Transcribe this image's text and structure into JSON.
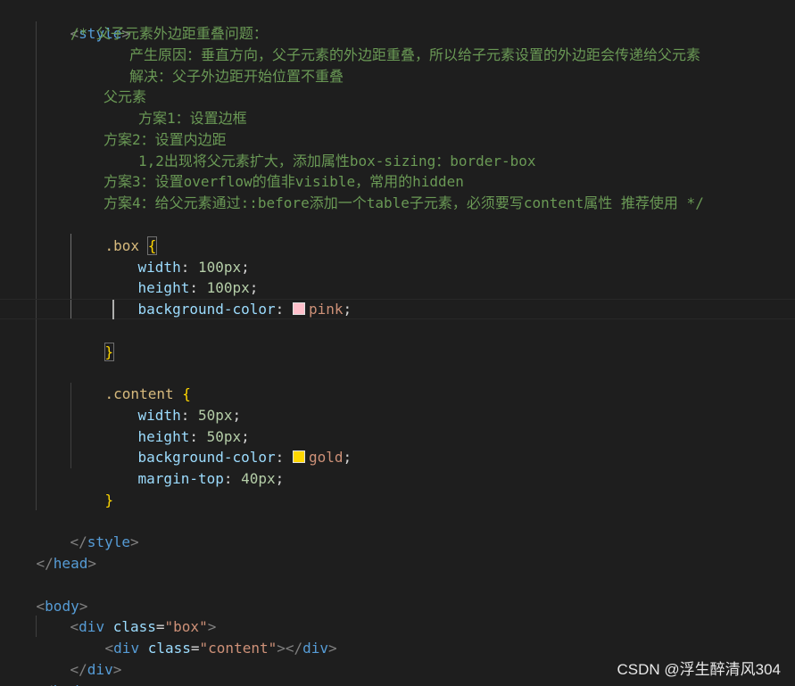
{
  "editor": {
    "lines": {
      "style_open": {
        "open": "<",
        "tag": "style",
        "close": ">"
      },
      "comment_1": "/* 父子元素外边距重叠问题：",
      "comment_2": "产生原因：垂直方向，父子元素的外边距重叠，所以给子元素设置的外边距会传递给父元素",
      "comment_3": "解决：父子外边距开始位置不重叠",
      "comment_4": "父元素",
      "comment_5": "方案1：设置边框",
      "comment_6": "方案2：设置内边距",
      "comment_7": "1,2出现将父元素扩大，添加属性box-sizing：border-box",
      "comment_8": "方案3：设置overflow的值非visible，常用的hidden",
      "comment_9": "方案4：给父元素通过::before添加一个table子元素，必须要写content属性 推荐使用 */",
      "box_selector": ".box",
      "box_width_prop": "width",
      "box_width_val": "100px",
      "box_height_prop": "height",
      "box_height_val": "100px",
      "box_bg_prop": "background-color",
      "box_bg_val": "pink",
      "content_selector": ".content",
      "content_width_prop": "width",
      "content_width_val": "50px",
      "content_height_prop": "height",
      "content_height_val": "50px",
      "content_bg_prop": "background-color",
      "content_bg_val": "gold",
      "content_margin_prop": "margin-top",
      "content_margin_val": "40px",
      "style_close_tag": "style",
      "head_close_tag": "head",
      "body_open_tag": "body",
      "div_tag": "div",
      "class_attr": "class",
      "box_class_value": "\"box\"",
      "content_class_value": "\"content\"",
      "body_close_tag": "body"
    },
    "punct": {
      "open_brace": "{",
      "close_brace": "}",
      "colon": ":",
      "semicolon": ";",
      "lt": "<",
      "gt": ">",
      "lt_slash": "</",
      "eq": "="
    }
  },
  "swatches": {
    "pink": "#ffc0cb",
    "gold": "#ffd700"
  },
  "watermark": "CSDN @浮生醉清风304"
}
